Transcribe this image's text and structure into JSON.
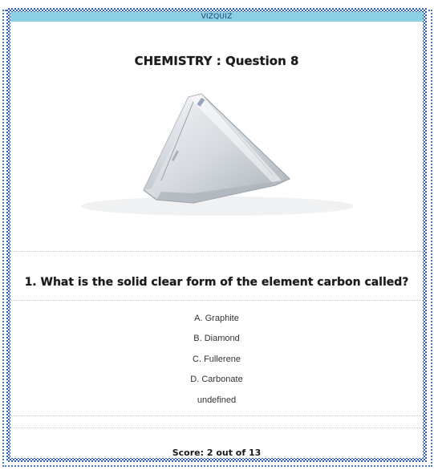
{
  "window": {
    "title": "VIZQUIZ"
  },
  "quiz": {
    "heading": "CHEMISTRY : Question 8",
    "question": "1. What is the solid clear form of the element carbon called?",
    "options": [
      "A. Graphite",
      "B. Diamond",
      "C. Fullerene",
      "D. Carbonate",
      "undefined"
    ],
    "score": "Score: 2 out of 13"
  },
  "image": {
    "subject": "rough-diamond-crystal"
  },
  "colors": {
    "titlebar": "#8cd0e6",
    "border": "#2f5fb0"
  }
}
